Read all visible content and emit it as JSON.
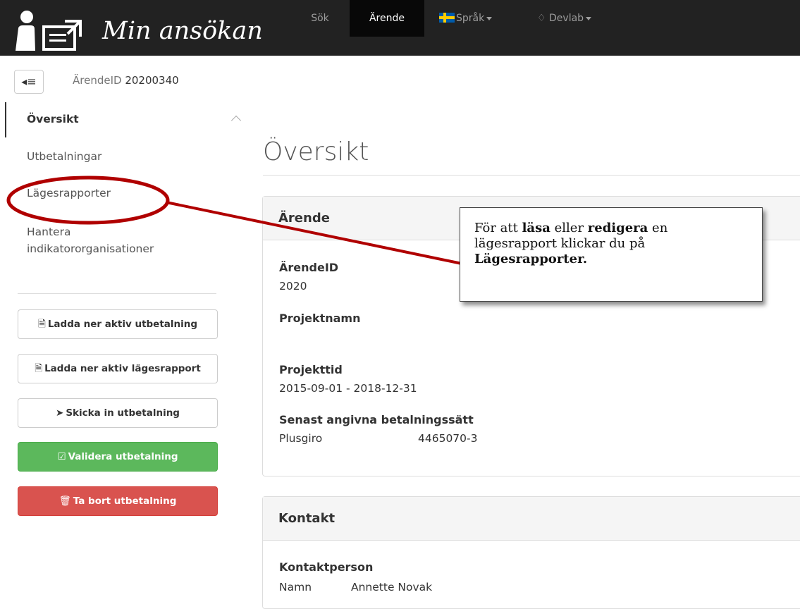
{
  "header": {
    "brand": "Min ansökan",
    "logo_icon": "person-document-icon",
    "nav": {
      "search": "Sök",
      "case": "Ärende",
      "language": "Språk",
      "devlab": "Devlab"
    }
  },
  "breadcrumb": {
    "label": "ÄrendeID",
    "value": "20200340"
  },
  "sidebar": {
    "items": [
      {
        "label": "Översikt",
        "active": true
      },
      {
        "label": "Utbetalningar"
      },
      {
        "label": "Lägesrapporter"
      },
      {
        "label": "Hantera indikatororganisationer"
      }
    ],
    "buttons": {
      "download_payment": "Ladda ner aktiv utbetalning",
      "download_report": "Ladda ner aktiv lägesrapport",
      "send_payment": "Skicka in utbetalning",
      "validate_payment": "Validera utbetalning",
      "delete_payment": "Ta bort utbetalning"
    }
  },
  "main": {
    "title": "Översikt",
    "case_panel": {
      "heading": "Ärende",
      "case_id_label": "ÄrendeID",
      "case_id_value": "2020",
      "project_name_label": "Projektnamn",
      "project_name_value": "",
      "project_time_label": "Projekttid",
      "project_time_value": "2015-09-01 - 2018-12-31",
      "payment_method_label": "Senast angivna betalningssätt",
      "payment_method_type": "Plusgiro",
      "payment_method_number": "4465070-3"
    },
    "contact_panel": {
      "heading": "Kontakt",
      "contact_person_label": "Kontaktperson",
      "name_label": "Namn",
      "name_value": "Annette Novak"
    }
  },
  "callout": {
    "text_1": "För att ",
    "bold_1": "läsa",
    "text_2": " eller ",
    "bold_2": "redigera",
    "text_3": " en lägesrapport klickar du på ",
    "bold_3": "Lägesrapporter."
  },
  "colors": {
    "navbar": "#222222",
    "success": "#5cb85c",
    "danger": "#d9534f",
    "annotation": "#b00000"
  }
}
